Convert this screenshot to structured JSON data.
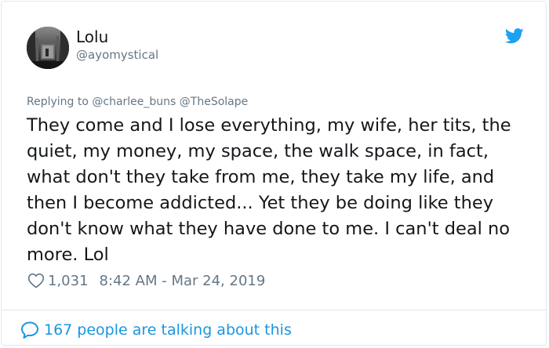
{
  "author": {
    "name": "Lolu",
    "handle": "@ayomystical"
  },
  "reply": {
    "prefix": "Replying to",
    "mentions": [
      "@charlee_buns",
      "@TheSolape"
    ]
  },
  "tweet": {
    "text": "They come and I lose everything, my wife, her tits, the quiet, my money, my space, the walk space, in fact, what don't they take from me, they take my life, and then I become addicted... Yet they be doing like they don't know what they have done to me. I can't deal no more. Lol",
    "likes": "1,031",
    "time": "8:42 AM - Mar 24, 2019"
  },
  "footer": {
    "label": "167 people are talking about this"
  },
  "icons": {
    "brand": "twitter-bird-icon",
    "like": "heart-icon",
    "conversation": "speech-bubble-icon"
  },
  "colors": {
    "brand_blue": "#1da1f2",
    "link_blue": "#1b95e0",
    "secondary_text": "#657786",
    "primary_text": "#14171a",
    "border": "#e1e8ed"
  }
}
